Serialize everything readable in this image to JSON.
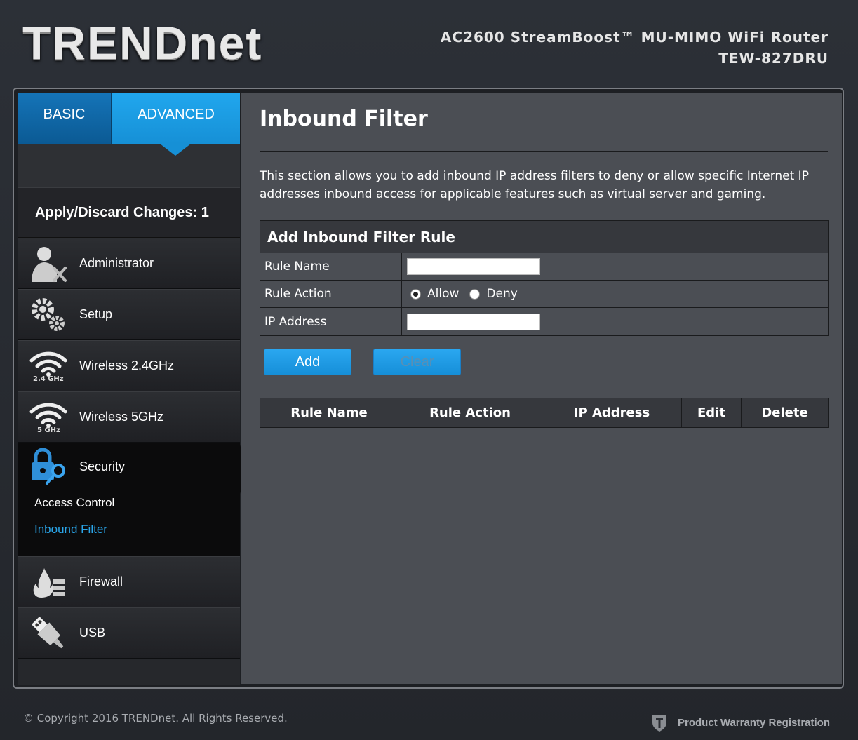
{
  "header": {
    "logo": "TRENDnet",
    "product_line": "AC2600 StreamBoost™ MU-MIMO WiFi Router",
    "model": "TEW-827DRU"
  },
  "tabs": [
    {
      "label": "BASIC",
      "active": false
    },
    {
      "label": "ADVANCED",
      "active": true
    }
  ],
  "apply": {
    "label": "Apply/Discard Changes: 1"
  },
  "nav": {
    "administrator": "Administrator",
    "setup": "Setup",
    "wireless24": "Wireless 2.4GHz",
    "wireless24_badge": "2.4 GHz",
    "wireless5": "Wireless 5GHz",
    "wireless5_badge": "5 GHz",
    "security": "Security",
    "access_control": "Access Control",
    "inbound_filter": "Inbound Filter",
    "firewall": "Firewall",
    "usb": "USB"
  },
  "content": {
    "title": "Inbound Filter",
    "description": "This section allows you to add inbound IP address filters to deny or allow specific Internet IP addresses inbound access for applicable features such as virtual server and gaming.",
    "form": {
      "heading": "Add Inbound Filter Rule",
      "rule_name_label": "Rule Name",
      "rule_name_value": "",
      "rule_action_label": "Rule Action",
      "allow_label": "Allow",
      "deny_label": "Deny",
      "selected_action": "Allow",
      "ip_label": "IP Address",
      "ip_value": ""
    },
    "buttons": {
      "add": "Add",
      "clear": "Clear"
    },
    "table_headers": [
      "Rule Name",
      "Rule Action",
      "IP Address",
      "Edit",
      "Delete"
    ]
  },
  "footer": {
    "copyright": "© Copyright 2016 TRENDnet. All Rights Reserved.",
    "warranty": "Product Warranty Registration"
  },
  "colors": {
    "accent": "#21a7ee",
    "active_link": "#2aa6ea",
    "content_bg": "#4b4e54"
  }
}
